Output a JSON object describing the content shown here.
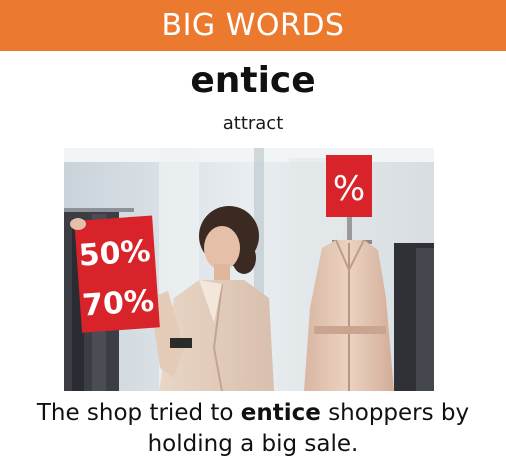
{
  "header": {
    "title": "BIG WORDS",
    "bg_color": "#ec7a2e"
  },
  "word": "entice",
  "definition": "attract",
  "photo": {
    "sign_left_line1": "50%",
    "sign_left_line2": "70%",
    "sign_right": "%",
    "sign_color": "#d9232a"
  },
  "sentence": {
    "before": "The shop tried to ",
    "keyword": "entice",
    "after": " shoppers by holding a big sale."
  }
}
